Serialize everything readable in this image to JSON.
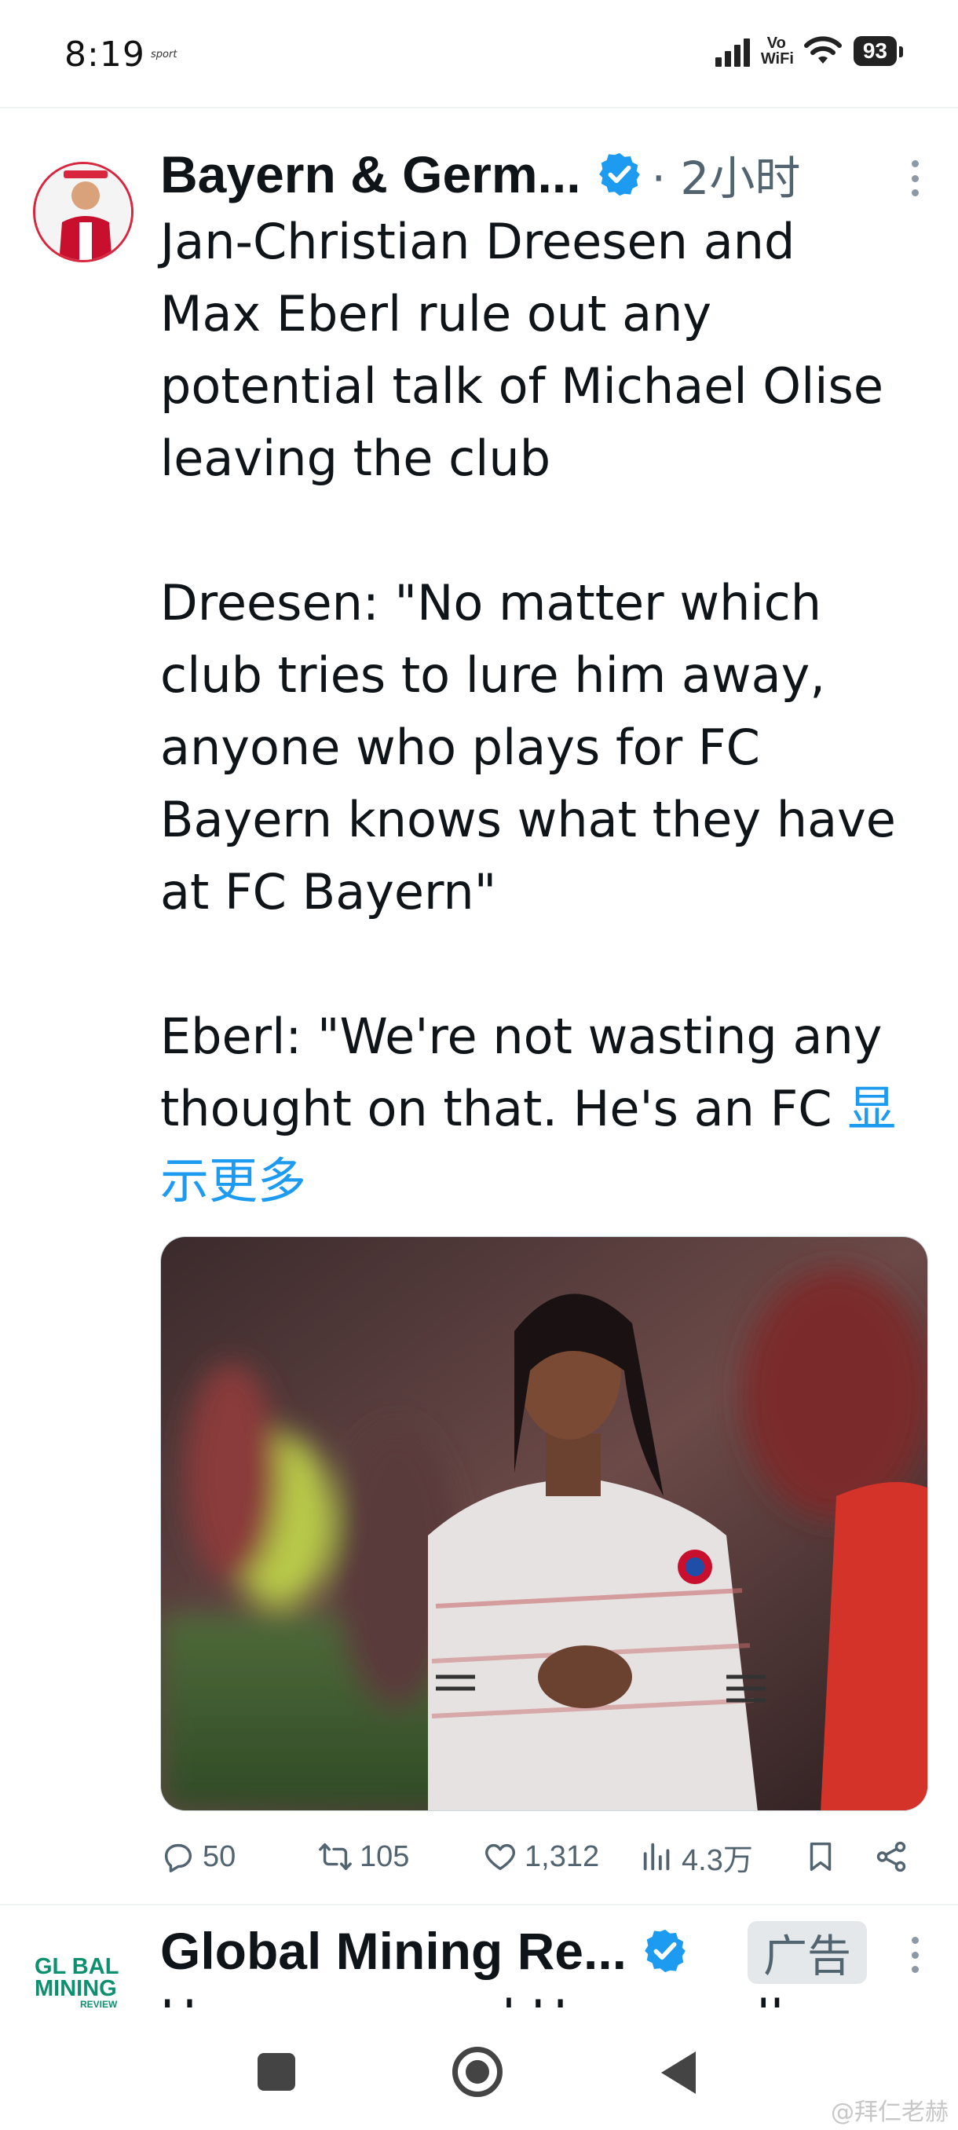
{
  "status_bar": {
    "time": "8:19",
    "app_tag": "sport",
    "network": "Vo WiFi",
    "battery": "93"
  },
  "tweet": {
    "author": "Bayern & Germ...",
    "time": "· 2小时",
    "text": "Jan-Christian Dreesen and\nMax Eberl rule out any\npotential talk of Michael Olise\nleaving the club\n\nDreesen: \"No matter which\nclub tries to lure him away,\nanyone who plays for FC\nBayern knows what they have\nat FC Bayern\"\n\nEberl: \"We're not wasting any\nthought on that. He's an FC ",
    "show_more": "显\n示更多",
    "media_icon": "player-photo",
    "actions": {
      "replies": "50",
      "retweets": "105",
      "likes": "1,312",
      "views": "4.3万"
    }
  },
  "ad_tweet": {
    "logo_line1": "GL BAL",
    "logo_line2": "MINING",
    "logo_line3": "REVIEW",
    "author": "Global Mining Re...",
    "badge": "广告",
    "text": "Have you read Honeywell"
  },
  "watermark": "@拜仁老赫",
  "colors": {
    "accent": "#1d9bf0",
    "text": "#0f1419",
    "muted": "#536471",
    "club_red": "#d7263d"
  }
}
